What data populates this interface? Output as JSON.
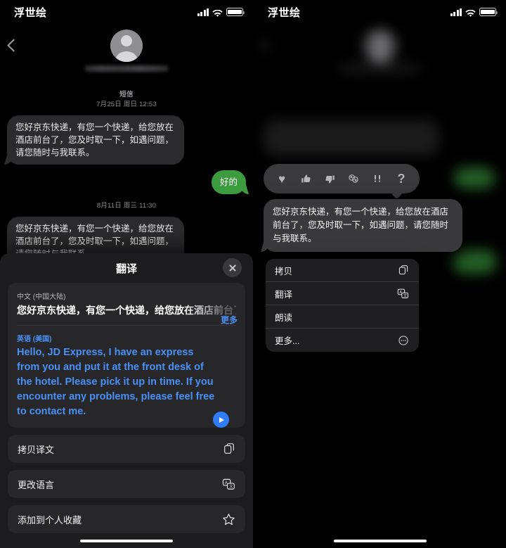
{
  "status_bar": {
    "carrier_or_title": "浮世绘",
    "icons": {
      "signal": "signal-bars-icon",
      "wifi": "wifi-icon",
      "battery": "battery-full-icon"
    }
  },
  "left_screen": {
    "header": {
      "back": "back-chevron-icon",
      "avatar": "contact-avatar",
      "contact_name": ""
    },
    "thread": [
      {
        "type": "timestamp",
        "service": "短信",
        "date": "7月25日 周日 12:53"
      },
      {
        "type": "message",
        "direction": "in",
        "text": "您好京东快递，有您一个快递，给您放在酒店前台了，您及时取一下，如遇问题，请您随时与我联系。"
      },
      {
        "type": "message",
        "direction": "out",
        "text": "好的"
      },
      {
        "type": "timestamp",
        "service": "",
        "date": "8月11日 周三 11:30"
      },
      {
        "type": "message",
        "direction": "in",
        "text": "您好京东快递，有您一个快递，给您放在酒店前台了，您及时取一下，如遇问题，请您随时与我联系。"
      }
    ],
    "translate_sheet": {
      "title": "翻译",
      "close_label": "close-icon",
      "source_language": "中文 (中国大陆)",
      "source_text": "您好京东快递，有您一个快递，给您放在酒店前台了，",
      "more_label": "更多",
      "target_language": "英语 (美国)",
      "target_text": "Hello, JD Express, I have an express from you and put it at the front desk of the hotel. Please pick it up in time. If you encounter any problems, please feel free to contact me.",
      "play_label": "play-audio-icon",
      "actions": [
        {
          "label": "拷贝译文",
          "icon": "copy-icon"
        },
        {
          "label": "更改语言",
          "icon": "translate-icon"
        },
        {
          "label": "添加到个人收藏",
          "icon": "star-icon"
        }
      ]
    }
  },
  "right_screen": {
    "tapbacks": [
      {
        "name": "heart-icon",
        "glyph": "♥"
      },
      {
        "name": "thumbs-up-icon",
        "glyph": "👍"
      },
      {
        "name": "thumbs-down-icon",
        "glyph": "👎"
      },
      {
        "name": "haha-icon",
        "glyph": "😂"
      },
      {
        "name": "exclamation-icon",
        "glyph": "‼"
      },
      {
        "name": "question-icon",
        "glyph": "?"
      }
    ],
    "focused_message": "您好京东快递，有您一个快递，给您放在酒店前台了，您及时取一下，如遇问题，请您随时与我联系。",
    "context_menu": [
      {
        "label": "拷贝",
        "icon": "copy-icon"
      },
      {
        "label": "翻译",
        "icon": "translate-icon"
      },
      {
        "label": "朗读",
        "icon": ""
      },
      {
        "label": "更多...",
        "icon": "more-ellipsis-icon"
      }
    ]
  },
  "colors": {
    "sent_bubble_green": "#3c9b3f",
    "received_bubble_gray": "#2b2b2d",
    "accent_blue": "#4a90f5",
    "sheet_background": "#1c1c1e",
    "screen_background": "#000000"
  }
}
